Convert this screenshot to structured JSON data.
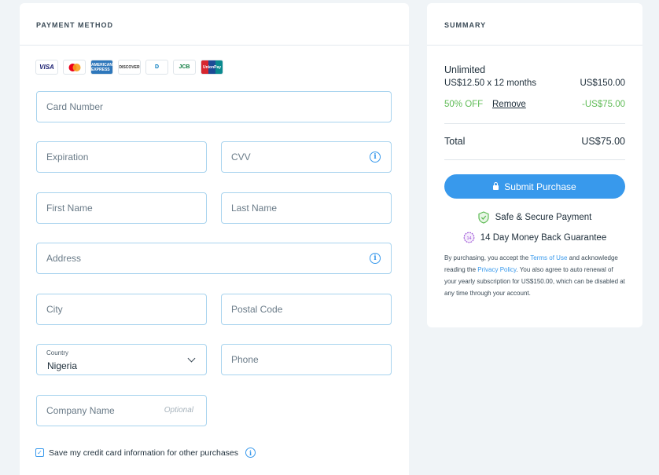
{
  "payment": {
    "title": "PAYMENT METHOD",
    "card_logos": [
      {
        "name": "visa-logo",
        "label": "VISA"
      },
      {
        "name": "mastercard-logo",
        "label": ""
      },
      {
        "name": "amex-logo",
        "label": "AMERICAN EXPRESS"
      },
      {
        "name": "discover-logo",
        "label": "DISCOVER"
      },
      {
        "name": "diners-logo",
        "label": "D"
      },
      {
        "name": "jcb-logo",
        "label": "JCB"
      },
      {
        "name": "unionpay-logo",
        "label": "UnionPay"
      }
    ],
    "fields": {
      "card_number": "Card Number",
      "expiration": "Expiration",
      "cvv": "CVV",
      "first_name": "First Name",
      "last_name": "Last Name",
      "address": "Address",
      "city": "City",
      "postal_code": "Postal Code",
      "country_label": "Country",
      "country_value": "Nigeria",
      "phone": "Phone",
      "company_name": "Company Name",
      "company_optional": "Optional"
    },
    "save_card_label": "Save my credit card information for other purchases",
    "save_card_checked": true
  },
  "summary": {
    "title": "SUMMARY",
    "plan_name": "Unlimited",
    "plan_price_detail": "US$12.50 x 12 months",
    "plan_price": "US$150.00",
    "discount_label": "50% OFF",
    "remove_label": "Remove",
    "discount_amount": "-US$75.00",
    "total_label": "Total",
    "total_amount": "US$75.00",
    "submit_label": "Submit Purchase",
    "secure_label": "Safe & Secure Payment",
    "guarantee_label": "14 Day Money Back Guarantee",
    "badge_number": "14",
    "legal": {
      "part1": "By purchasing, you accept the ",
      "terms_link": "Terms of Use",
      "part2": " and acknowledge reading the ",
      "privacy_link": "Privacy Policy",
      "part3": ". You also agree to auto renewal of your yearly subscription for US$150.00, which can be disabled at any time through your account."
    }
  },
  "colors": {
    "accent": "#3899ec",
    "field_border": "#a7d3ee",
    "discount_green": "#60bc57",
    "background": "#f0f4f7"
  }
}
